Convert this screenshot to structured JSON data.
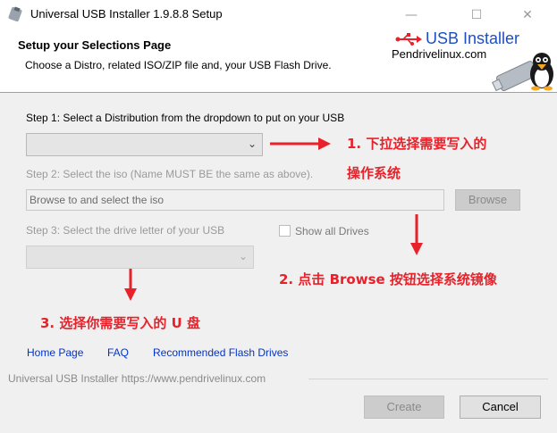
{
  "window": {
    "title": "Universal USB Installer 1.9.8.8 Setup",
    "controls": {
      "minimize": "—",
      "maximize": "☐",
      "close": "✕"
    }
  },
  "header": {
    "title": "Setup your Selections Page",
    "subtitle": "Choose a Distro, related ISO/ZIP file and, your USB Flash Drive.",
    "logo_title": "USB Installer",
    "logo_site": "Pendrivelinux.com"
  },
  "step1": {
    "label": "Step 1: Select a Distribution from the dropdown to put on your USB",
    "selected": ""
  },
  "step2": {
    "label": "Step 2: Select the iso (Name MUST BE the same as above).",
    "field_value": "Browse to and select the iso",
    "browse_button": "Browse"
  },
  "step3": {
    "label": "Step 3: Select the drive letter of your USB",
    "show_all_drives": "Show all Drives",
    "selected": ""
  },
  "annotations": {
    "a1_line1": "1. 下拉选择需要写入的",
    "a1_line2": "操作系统",
    "a2": "2. 点击 Browse 按钮选择系统镜像",
    "a3": "3. 选择你需要写入的 U 盘",
    "color": "#e8212a"
  },
  "links": {
    "home": "Home Page",
    "faq": "FAQ",
    "recommended": "Recommended Flash Drives"
  },
  "footer": {
    "text": "Universal USB Installer https://www.pendrivelinux.com",
    "create_button": "Create",
    "cancel_button": "Cancel"
  },
  "colors": {
    "link": "#0033cc",
    "logo_blue": "#1e4fc2",
    "annotation_red": "#e8212a"
  }
}
